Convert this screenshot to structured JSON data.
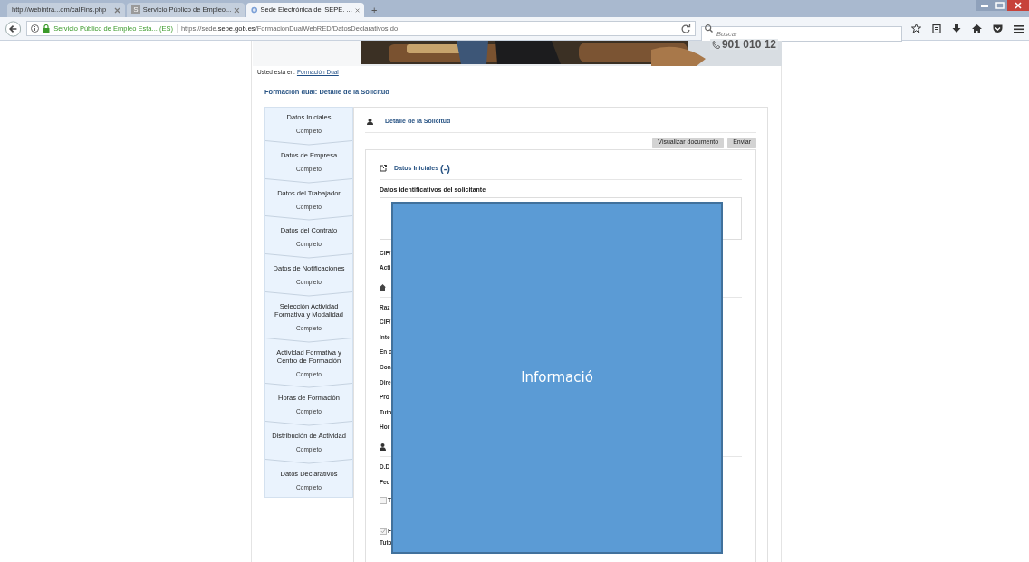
{
  "browser": {
    "tabs": [
      {
        "title": "http://webintra...om/calFins.php",
        "selected": false,
        "kind": "plain"
      },
      {
        "title": "Servicio Público de Empleo...",
        "selected": false,
        "kind": "letter",
        "letter": "S"
      },
      {
        "title": "Sede Electrónica del SEPE. ...",
        "selected": true,
        "kind": "globe"
      }
    ],
    "new_tab": "+",
    "identity": "Servicio Público de Empleo Esta... (ES)",
    "url": {
      "prefix": "https://sede.",
      "domain": "sepe.gob.es",
      "path": "/FormacionDualWebRED/DatosDeclarativos.do"
    },
    "search_placeholder": "Buscar"
  },
  "page": {
    "phone": "901 010 12",
    "breadcrumb_label": "Usted está en:",
    "breadcrumb_link": "Formación Dual",
    "title": "Formación dual: Detalle de la Solicitud",
    "steps": [
      {
        "name": "Datos Iniciales",
        "status": "Completo"
      },
      {
        "name": "Datos de Empresa",
        "status": "Completo"
      },
      {
        "name": "Datos del Trabajador",
        "status": "Completo"
      },
      {
        "name": "Datos del Contrato",
        "status": "Completo"
      },
      {
        "name": "Datos de Notificaciones",
        "status": "Completo"
      },
      {
        "name": "Selección Actividad Formativa y Modalidad",
        "status": "Completo"
      },
      {
        "name": "Actividad Formativa y Centro de Formación",
        "status": "Completo"
      },
      {
        "name": "Horas de Formación",
        "status": "Completo"
      },
      {
        "name": "Distribución de Actividad",
        "status": "Completo"
      },
      {
        "name": "Datos Declarativos",
        "status": "Completo"
      }
    ],
    "detail_title": "Detalle de la Solicitud",
    "buttons": [
      "Visualizar documento",
      "Enviar"
    ],
    "section": {
      "title": "Datos Iniciales",
      "toggle": "(-)"
    },
    "subsection": "Datos identificativos del solicitante",
    "rows": [
      {
        "kind": "label",
        "text": "CIF/"
      },
      {
        "kind": "label",
        "text": "Acti"
      },
      {
        "kind": "home"
      },
      {
        "kind": "divider"
      },
      {
        "kind": "label",
        "text": "Raz"
      },
      {
        "kind": "label",
        "text": "CIF/"
      },
      {
        "kind": "label",
        "text": "Inte"
      },
      {
        "kind": "label",
        "text": "En c"
      },
      {
        "kind": "label",
        "text": "Con"
      },
      {
        "kind": "label",
        "text": "Dire"
      },
      {
        "kind": "label",
        "text": "Pro"
      },
      {
        "kind": "label",
        "text": "Tuto"
      },
      {
        "kind": "label",
        "text": "Hor"
      },
      {
        "kind": "person"
      },
      {
        "kind": "divider"
      },
      {
        "kind": "label",
        "text": "D.D"
      },
      {
        "kind": "label",
        "text": "Fec"
      },
      {
        "kind": "checkbox",
        "text": "T",
        "checked": false
      },
      {
        "kind": "gap"
      },
      {
        "kind": "checkbox",
        "text": "F",
        "checked": true
      },
      {
        "kind": "label",
        "text": "Tuto"
      }
    ]
  },
  "overlay": {
    "text": "Informació"
  }
}
